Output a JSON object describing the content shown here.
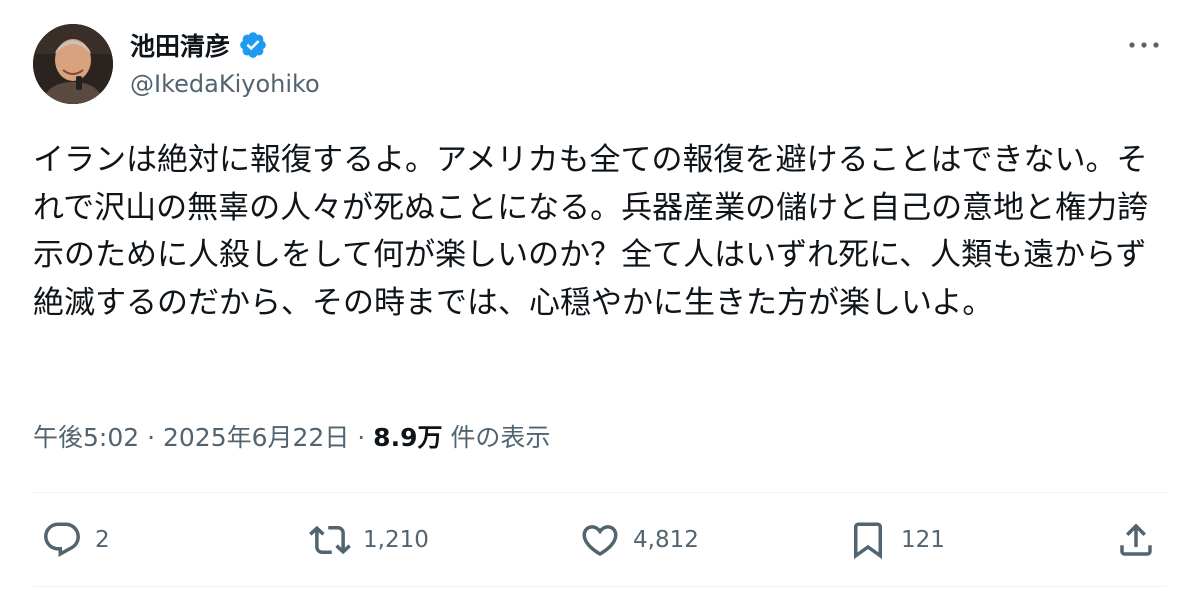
{
  "author": {
    "display_name": "池田清彦",
    "handle": "@IkedaKiyohiko",
    "verified": true,
    "avatar_icon": "profile-photo"
  },
  "tweet": {
    "text": "イランは絶対に報復するよ。アメリカも全ての報復を避けることはできない。それで沢山の無辜の人々が死ぬことになる。兵器産業の儲けと自己の意地と権力誇示のために人殺しをして何が楽しいのか？全て人はいずれ死に、人類も遠からず絶滅するのだから、その時までは、心穏やかに生きた方が楽しいよ。"
  },
  "meta": {
    "time": "午後5:02",
    "separator": " · ",
    "date": "2025年6月22日",
    "views_count": "8.9万",
    "views_label": "件の表示"
  },
  "actions": {
    "reply_count": "2",
    "retweet_count": "1,210",
    "like_count": "4,812",
    "bookmark_count": "121"
  },
  "colors": {
    "text_primary": "#0f1419",
    "text_secondary": "#536471",
    "verified_blue": "#1d9bf0",
    "divider": "#eff3f4"
  }
}
